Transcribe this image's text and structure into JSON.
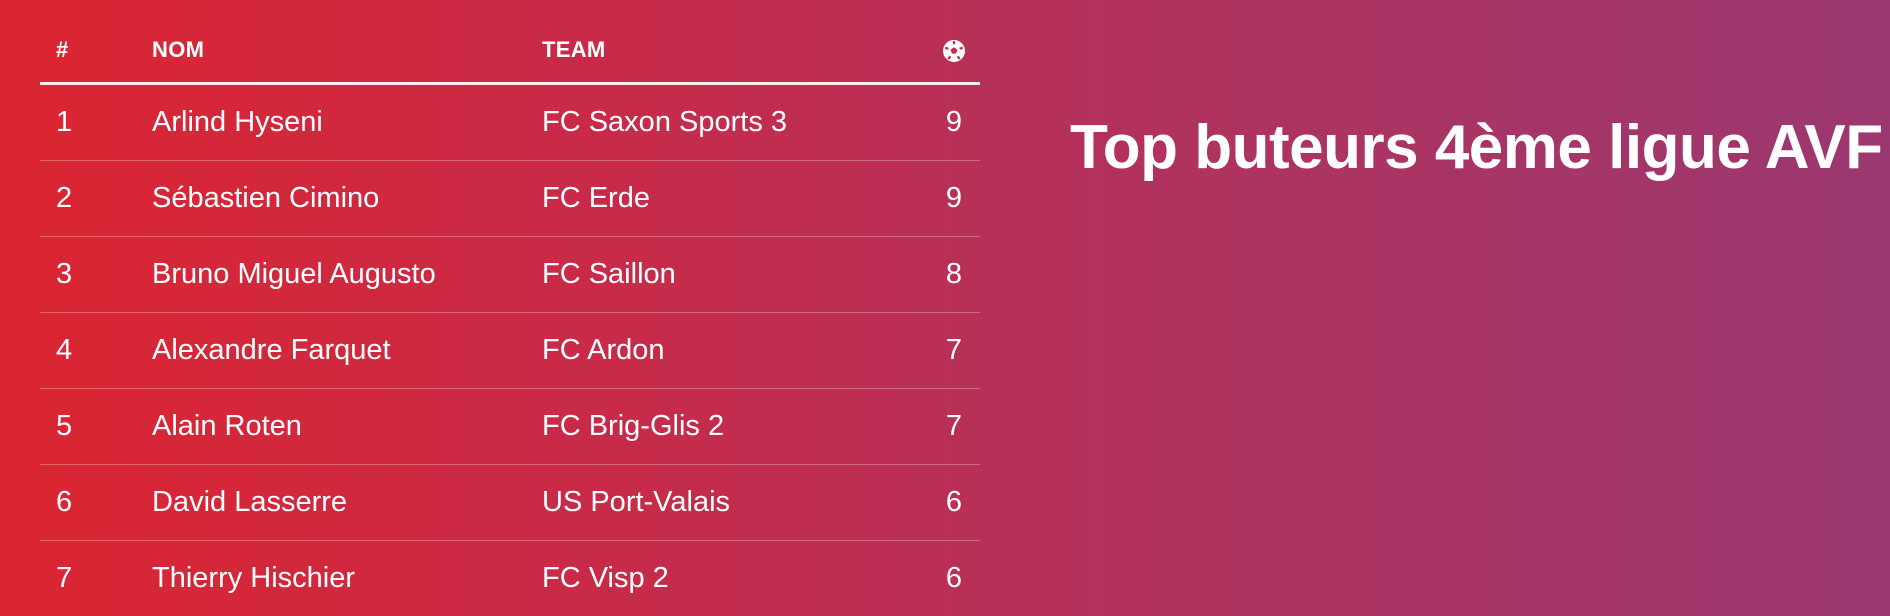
{
  "title": "Top buteurs 4ème ligue AVF",
  "table": {
    "headers": {
      "rank": "#",
      "name": "NOM",
      "team": "TEAM",
      "goals_icon": "soccer-ball-icon"
    },
    "rows": [
      {
        "rank": "1",
        "name": "Arlind Hyseni",
        "team": "FC Saxon Sports 3",
        "goals": "9"
      },
      {
        "rank": "2",
        "name": "Sébastien Cimino",
        "team": "FC Erde",
        "goals": "9"
      },
      {
        "rank": "3",
        "name": "Bruno Miguel Augusto",
        "team": "FC Saillon",
        "goals": "8"
      },
      {
        "rank": "4",
        "name": "Alexandre Farquet",
        "team": "FC Ardon",
        "goals": "7"
      },
      {
        "rank": "5",
        "name": "Alain Roten",
        "team": "FC Brig-Glis 2",
        "goals": "7"
      },
      {
        "rank": "6",
        "name": "David Lasserre",
        "team": "US Port-Valais",
        "goals": "6"
      },
      {
        "rank": "7",
        "name": "Thierry Hischier",
        "team": "FC Visp 2",
        "goals": "6"
      }
    ]
  },
  "colors": {
    "gradient_start": "#dc2531",
    "gradient_end": "#9b3870",
    "text": "#ffffff"
  }
}
